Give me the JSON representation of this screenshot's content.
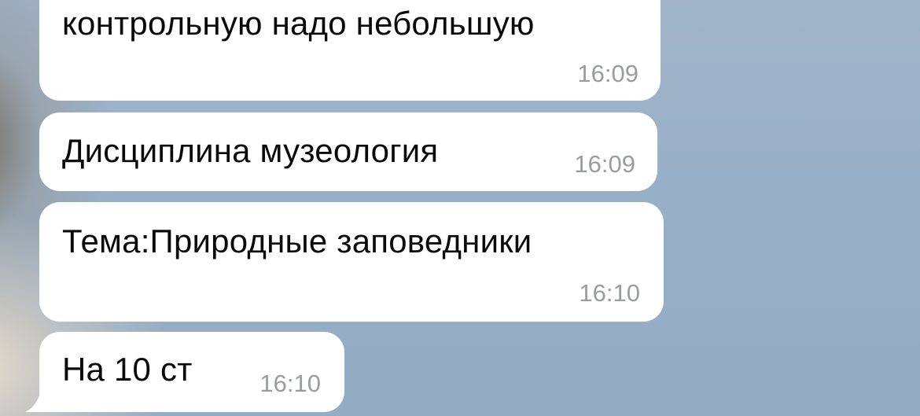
{
  "messages": [
    {
      "text": "контрольную надо небольшую",
      "time": "16:09"
    },
    {
      "text": "Дисциплина музеология",
      "time": "16:09"
    },
    {
      "text": "Тема:Природные заповедники",
      "time": "16:10"
    },
    {
      "text": "На 10 ст",
      "time": "16:10"
    }
  ],
  "colors": {
    "bubble": "#ffffff",
    "text": "#0a0a0a",
    "time": "#9a9ca0",
    "background": "#98b0c7"
  }
}
